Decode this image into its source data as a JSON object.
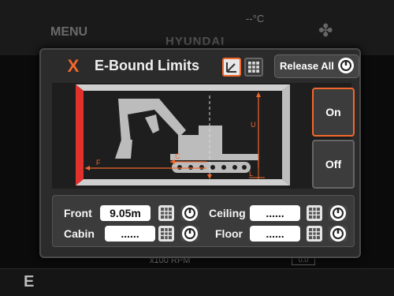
{
  "background": {
    "menu_label": "MENU",
    "brand": "HYUNDAI",
    "temperature": "--°C",
    "rpm_label": "x100 RPM",
    "drive_mode": "E",
    "gauge_value": "0.0"
  },
  "dialog": {
    "close_symbol": "X",
    "title": "E-Bound Limits",
    "mode_buttons": [
      "diagram-mode-icon",
      "grid-mode-icon"
    ],
    "release_all_label": "Release All"
  },
  "diagram": {
    "labels": {
      "front": "F",
      "cabin": "C",
      "ceiling": "U",
      "floor": "L"
    },
    "colors": {
      "accent": "#f2682c",
      "front_wall": "#e0312d",
      "machine": "#bcbcbc"
    }
  },
  "toggle": {
    "on_label": "On",
    "off_label": "Off",
    "selected": "On"
  },
  "limits": {
    "front": {
      "label": "Front",
      "value": "9.05m"
    },
    "cabin": {
      "label": "Cabin",
      "value": "......"
    },
    "ceiling": {
      "label": "Ceiling",
      "value": "......"
    },
    "floor": {
      "label": "Floor",
      "value": "......"
    }
  }
}
